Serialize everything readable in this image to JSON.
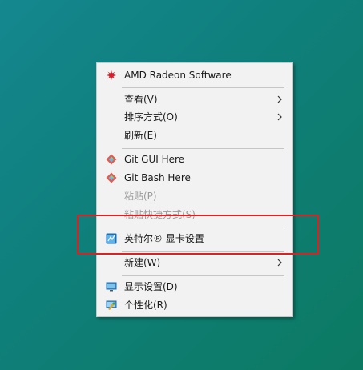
{
  "menu": {
    "items": [
      {
        "label": "AMD Radeon Software",
        "icon": "amd-radeon-icon",
        "enabled": true
      },
      {
        "label": "查看(V)",
        "submenu": true,
        "enabled": true
      },
      {
        "label": "排序方式(O)",
        "submenu": true,
        "enabled": true
      },
      {
        "label": "刷新(E)",
        "enabled": true
      },
      {
        "label": "Git GUI Here",
        "icon": "git-icon",
        "enabled": true
      },
      {
        "label": "Git Bash Here",
        "icon": "git-icon",
        "enabled": true
      },
      {
        "label": "粘贴(P)",
        "enabled": false
      },
      {
        "label": "粘贴快捷方式(S)",
        "enabled": false
      },
      {
        "label": "英特尔® 显卡设置",
        "icon": "intel-graphics-icon",
        "enabled": true
      },
      {
        "label": "新建(W)",
        "submenu": true,
        "enabled": true
      },
      {
        "label": "显示设置(D)",
        "icon": "display-icon",
        "enabled": true
      },
      {
        "label": "个性化(R)",
        "icon": "personalize-icon",
        "enabled": true
      }
    ]
  },
  "colors": {
    "highlight_border": "#e02020",
    "amd_red": "#d4202c",
    "menu_bg": "#f2f2f2"
  }
}
